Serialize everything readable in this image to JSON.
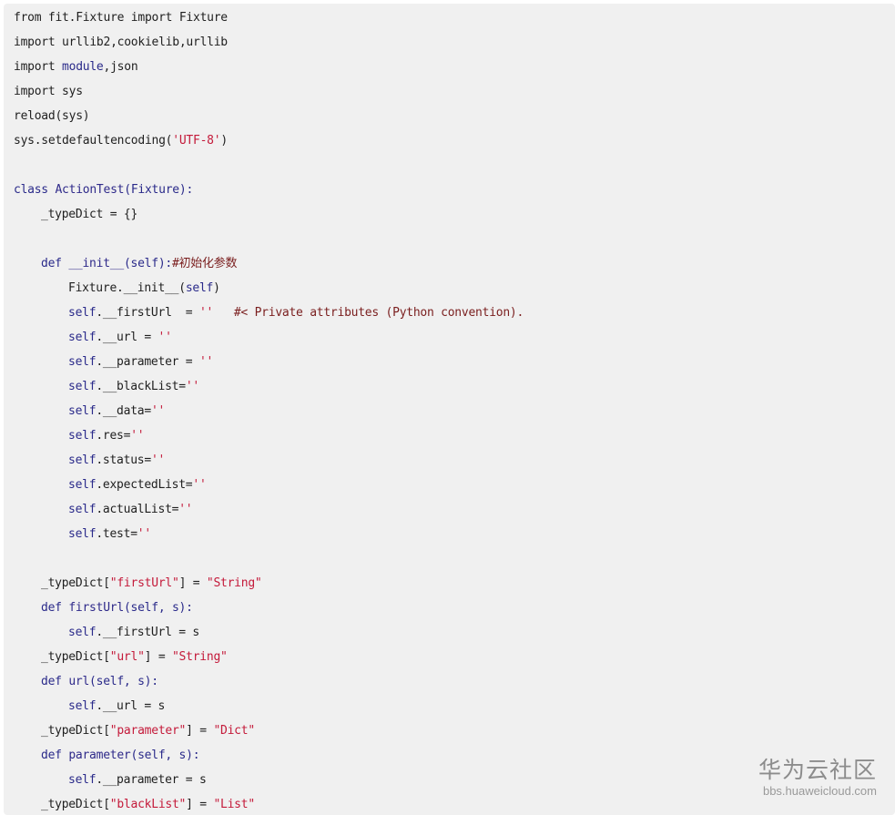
{
  "code_lines": [
    {
      "indent": 0,
      "tokens": [
        {
          "t": "from fit.Fixture import Fixture",
          "c": "plain"
        }
      ]
    },
    {
      "indent": 0,
      "tokens": [
        {
          "t": "import urllib2,cookielib,urllib",
          "c": "plain"
        }
      ]
    },
    {
      "indent": 0,
      "tokens": [
        {
          "t": "import ",
          "c": "plain"
        },
        {
          "t": "module",
          "c": "kw"
        },
        {
          "t": ",json",
          "c": "plain"
        }
      ]
    },
    {
      "indent": 0,
      "tokens": [
        {
          "t": "import sys",
          "c": "plain"
        }
      ]
    },
    {
      "indent": 0,
      "tokens": [
        {
          "t": "reload(sys)",
          "c": "plain"
        }
      ]
    },
    {
      "indent": 0,
      "tokens": [
        {
          "t": "sys.setdefaultencoding(",
          "c": "plain"
        },
        {
          "t": "'UTF-8'",
          "c": "str"
        },
        {
          "t": ")",
          "c": "plain"
        }
      ]
    },
    {
      "indent": 0,
      "tokens": []
    },
    {
      "indent": 0,
      "tokens": [
        {
          "t": "class ",
          "c": "kw"
        },
        {
          "t": "ActionTest",
          "c": "fn"
        },
        {
          "t": "(Fixture):",
          "c": "kw"
        }
      ]
    },
    {
      "indent": 1,
      "tokens": [
        {
          "t": "_typeDict = {}",
          "c": "plain"
        }
      ]
    },
    {
      "indent": 0,
      "tokens": []
    },
    {
      "indent": 1,
      "tokens": [
        {
          "t": "def ",
          "c": "kw"
        },
        {
          "t": "__init__",
          "c": "fn"
        },
        {
          "t": "(self):",
          "c": "kw"
        },
        {
          "t": "#初始化参数",
          "c": "com"
        }
      ]
    },
    {
      "indent": 2,
      "tokens": [
        {
          "t": "Fixture.__init__(",
          "c": "plain"
        },
        {
          "t": "self",
          "c": "kw"
        },
        {
          "t": ")",
          "c": "plain"
        }
      ]
    },
    {
      "indent": 2,
      "tokens": [
        {
          "t": "self",
          "c": "kw"
        },
        {
          "t": ".__firstUrl  = ",
          "c": "plain"
        },
        {
          "t": "''",
          "c": "str"
        },
        {
          "t": "   #< Private attributes (Python convention).",
          "c": "com"
        }
      ]
    },
    {
      "indent": 2,
      "tokens": [
        {
          "t": "self",
          "c": "kw"
        },
        {
          "t": ".__url = ",
          "c": "plain"
        },
        {
          "t": "''",
          "c": "str"
        }
      ]
    },
    {
      "indent": 2,
      "tokens": [
        {
          "t": "self",
          "c": "kw"
        },
        {
          "t": ".__parameter = ",
          "c": "plain"
        },
        {
          "t": "''",
          "c": "str"
        }
      ]
    },
    {
      "indent": 2,
      "tokens": [
        {
          "t": "self",
          "c": "kw"
        },
        {
          "t": ".__blackList=",
          "c": "plain"
        },
        {
          "t": "''",
          "c": "str"
        }
      ]
    },
    {
      "indent": 2,
      "tokens": [
        {
          "t": "self",
          "c": "kw"
        },
        {
          "t": ".__data=",
          "c": "plain"
        },
        {
          "t": "''",
          "c": "str"
        }
      ]
    },
    {
      "indent": 2,
      "tokens": [
        {
          "t": "self",
          "c": "kw"
        },
        {
          "t": ".res=",
          "c": "plain"
        },
        {
          "t": "''",
          "c": "str"
        }
      ]
    },
    {
      "indent": 2,
      "tokens": [
        {
          "t": "self",
          "c": "kw"
        },
        {
          "t": ".status=",
          "c": "plain"
        },
        {
          "t": "''",
          "c": "str"
        }
      ]
    },
    {
      "indent": 2,
      "tokens": [
        {
          "t": "self",
          "c": "kw"
        },
        {
          "t": ".expectedList=",
          "c": "plain"
        },
        {
          "t": "''",
          "c": "str"
        }
      ]
    },
    {
      "indent": 2,
      "tokens": [
        {
          "t": "self",
          "c": "kw"
        },
        {
          "t": ".actualList=",
          "c": "plain"
        },
        {
          "t": "''",
          "c": "str"
        }
      ]
    },
    {
      "indent": 2,
      "tokens": [
        {
          "t": "self",
          "c": "kw"
        },
        {
          "t": ".test=",
          "c": "plain"
        },
        {
          "t": "''",
          "c": "str"
        }
      ]
    },
    {
      "indent": 0,
      "tokens": []
    },
    {
      "indent": 1,
      "tokens": [
        {
          "t": "_typeDict[",
          "c": "plain"
        },
        {
          "t": "\"firstUrl\"",
          "c": "str"
        },
        {
          "t": "] = ",
          "c": "plain"
        },
        {
          "t": "\"String\"",
          "c": "str"
        }
      ]
    },
    {
      "indent": 1,
      "tokens": [
        {
          "t": "def ",
          "c": "kw"
        },
        {
          "t": "firstUrl",
          "c": "fn"
        },
        {
          "t": "(self, s):",
          "c": "kw"
        }
      ]
    },
    {
      "indent": 2,
      "tokens": [
        {
          "t": "self",
          "c": "kw"
        },
        {
          "t": ".__firstUrl = s",
          "c": "plain"
        }
      ]
    },
    {
      "indent": 1,
      "tokens": [
        {
          "t": "_typeDict[",
          "c": "plain"
        },
        {
          "t": "\"url\"",
          "c": "str"
        },
        {
          "t": "] = ",
          "c": "plain"
        },
        {
          "t": "\"String\"",
          "c": "str"
        }
      ]
    },
    {
      "indent": 1,
      "tokens": [
        {
          "t": "def ",
          "c": "kw"
        },
        {
          "t": "url",
          "c": "fn"
        },
        {
          "t": "(self, s):",
          "c": "kw"
        }
      ]
    },
    {
      "indent": 2,
      "tokens": [
        {
          "t": "self",
          "c": "kw"
        },
        {
          "t": ".__url = s",
          "c": "plain"
        }
      ]
    },
    {
      "indent": 1,
      "tokens": [
        {
          "t": "_typeDict[",
          "c": "plain"
        },
        {
          "t": "\"parameter\"",
          "c": "str"
        },
        {
          "t": "] = ",
          "c": "plain"
        },
        {
          "t": "\"Dict\"",
          "c": "str"
        }
      ]
    },
    {
      "indent": 1,
      "tokens": [
        {
          "t": "def ",
          "c": "kw"
        },
        {
          "t": "parameter",
          "c": "fn"
        },
        {
          "t": "(self, s):",
          "c": "kw"
        }
      ]
    },
    {
      "indent": 2,
      "tokens": [
        {
          "t": "self",
          "c": "kw"
        },
        {
          "t": ".__parameter = s",
          "c": "plain"
        }
      ]
    },
    {
      "indent": 1,
      "tokens": [
        {
          "t": "_typeDict[",
          "c": "plain"
        },
        {
          "t": "\"blackList\"",
          "c": "str"
        },
        {
          "t": "] = ",
          "c": "plain"
        },
        {
          "t": "\"List\"",
          "c": "str"
        }
      ]
    }
  ],
  "watermark": {
    "title": "华为云社区",
    "subtitle": "bbs.huaweicloud.com"
  },
  "colors": {
    "background": "#f0f0f0",
    "keyword": "#2a2a8a",
    "string": "#c41a3a",
    "comment": "#7a1e1e",
    "text": "#1f1f1f"
  }
}
